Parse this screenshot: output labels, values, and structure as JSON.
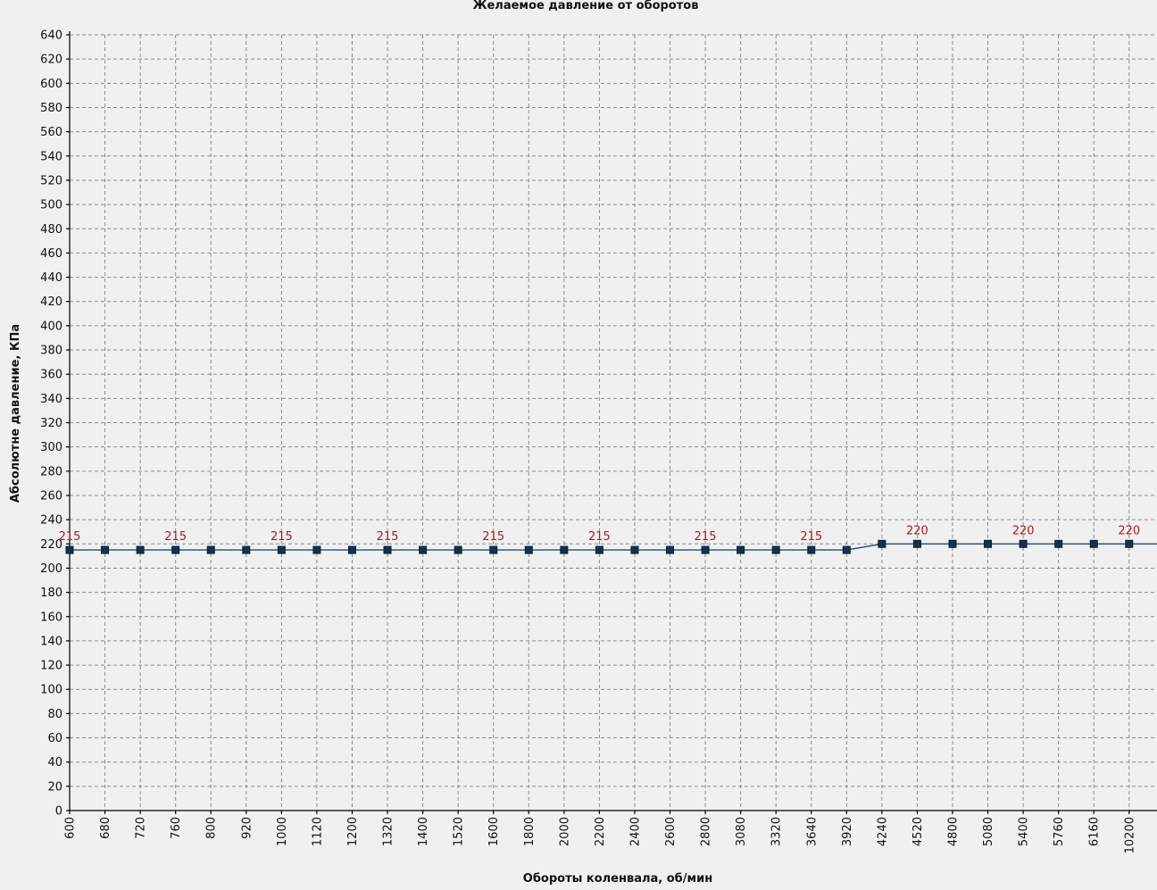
{
  "chart_data": {
    "type": "line",
    "title": "Желаемое давление от оборотов",
    "xlabel": "Обороты коленвала, об/мин",
    "ylabel": "Абсолютне давление, КПа",
    "categories": [
      "600",
      "680",
      "720",
      "760",
      "800",
      "920",
      "1000",
      "1120",
      "1200",
      "1320",
      "1400",
      "1520",
      "1600",
      "1800",
      "2000",
      "2200",
      "2400",
      "2600",
      "2800",
      "3080",
      "3320",
      "3640",
      "3920",
      "4240",
      "4520",
      "4800",
      "5080",
      "5400",
      "5760",
      "6160",
      "10200"
    ],
    "series": [
      {
        "values": [
          215,
          215,
          215,
          215,
          215,
          215,
          215,
          215,
          215,
          215,
          215,
          215,
          215,
          215,
          215,
          215,
          215,
          215,
          215,
          215,
          215,
          215,
          215,
          220,
          220,
          220,
          220,
          220,
          220,
          220,
          220
        ]
      }
    ],
    "data_labels": [
      {
        "index": 0,
        "text": "215"
      },
      {
        "index": 3,
        "text": "215"
      },
      {
        "index": 6,
        "text": "215"
      },
      {
        "index": 9,
        "text": "215"
      },
      {
        "index": 12,
        "text": "215"
      },
      {
        "index": 15,
        "text": "215"
      },
      {
        "index": 18,
        "text": "215"
      },
      {
        "index": 21,
        "text": "215"
      },
      {
        "index": 24,
        "text": "220"
      },
      {
        "index": 27,
        "text": "220"
      },
      {
        "index": 30,
        "text": "220"
      }
    ],
    "ylim": [
      0,
      640
    ],
    "ytick_step": 20,
    "grid": true,
    "legend": "none",
    "colors": {
      "line": "#1f4e79",
      "marker": "#14324f",
      "data_label": "#b01818",
      "grid": "#8a8a8a",
      "background": "#f0f0f0"
    }
  }
}
